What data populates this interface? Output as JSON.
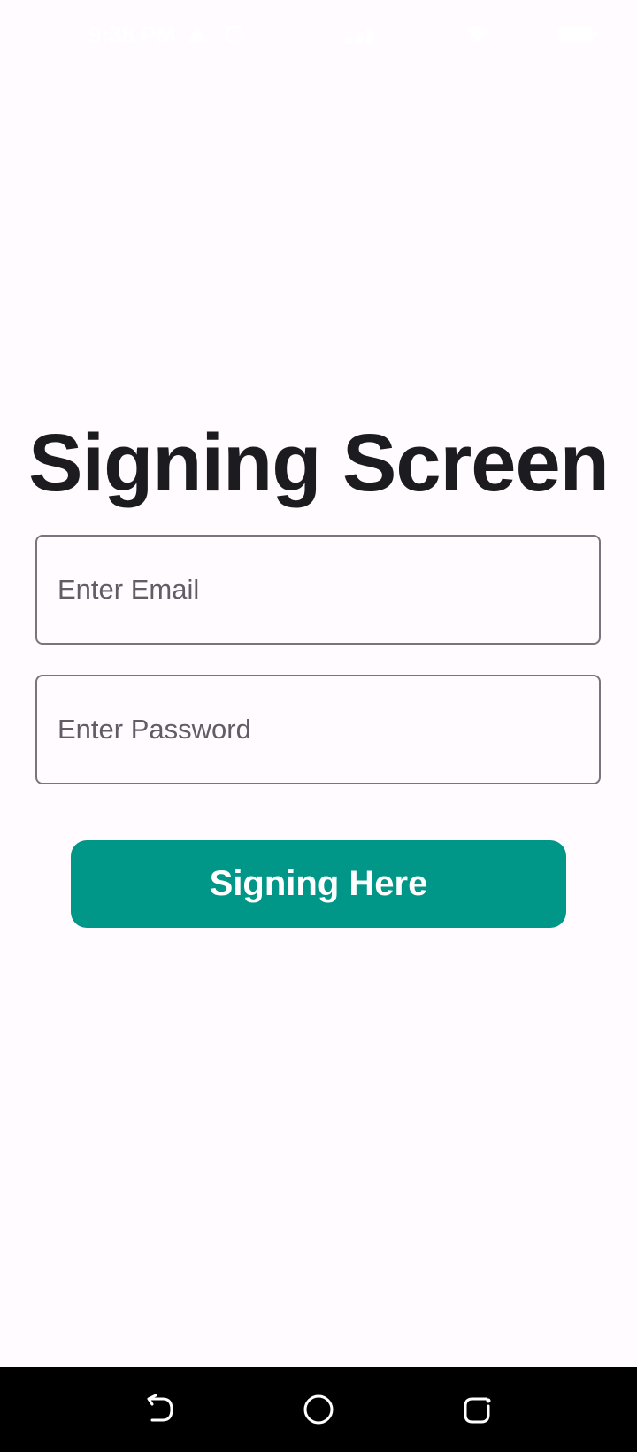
{
  "status_bar": {
    "time": "9:38 PM",
    "icons": [
      "warning-icon",
      "sync-icon",
      "signal-icon",
      "wifi-icon",
      "battery-icon"
    ]
  },
  "screen": {
    "title": "Signing Screen"
  },
  "form": {
    "email_placeholder": "Enter Email",
    "password_placeholder": "Enter Password",
    "submit_label": "Signing Here"
  },
  "colors": {
    "background": "#fffbfe",
    "accent": "#009688",
    "title_text": "#1c1b1f",
    "field_border": "#79747e",
    "placeholder_text": "#625c66",
    "nav_bar": "#000000"
  },
  "nav_bar": {
    "icons": [
      "back-icon",
      "home-icon",
      "recent-apps-icon"
    ]
  }
}
